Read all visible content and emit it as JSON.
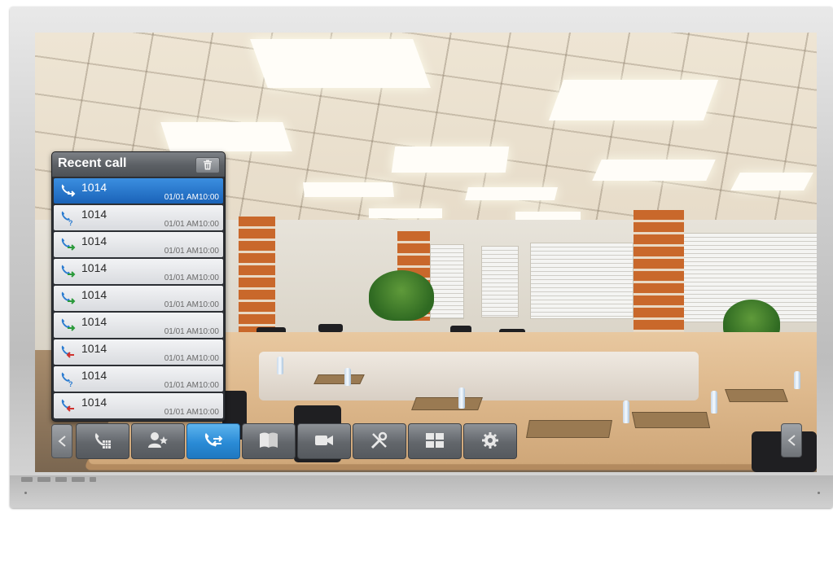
{
  "recent_call": {
    "title": "Recent call",
    "calls": [
      {
        "number": "1014",
        "time": "01/01 AM10:00",
        "type": "outgoing",
        "selected": true
      },
      {
        "number": "1014",
        "time": "01/01 AM10:00",
        "type": "missed"
      },
      {
        "number": "1014",
        "time": "01/01 AM10:00",
        "type": "outgoing"
      },
      {
        "number": "1014",
        "time": "01/01 AM10:00",
        "type": "outgoing"
      },
      {
        "number": "1014",
        "time": "01/01 AM10:00",
        "type": "outgoing"
      },
      {
        "number": "1014",
        "time": "01/01 AM10:00",
        "type": "outgoing"
      },
      {
        "number": "1014",
        "time": "01/01 AM10:00",
        "type": "incoming"
      },
      {
        "number": "1014",
        "time": "01/01 AM10:00",
        "type": "missed"
      },
      {
        "number": "1014",
        "time": "01/01 AM10:00",
        "type": "incoming"
      }
    ]
  },
  "toolbar": {
    "buttons": [
      {
        "icon": "dialpad-icon",
        "active": false
      },
      {
        "icon": "contacts-icon",
        "active": false
      },
      {
        "icon": "recent-calls-icon",
        "active": true
      },
      {
        "icon": "phonebook-icon",
        "active": false
      },
      {
        "icon": "video-camera-icon",
        "active": false
      },
      {
        "icon": "tools-icon",
        "active": false
      },
      {
        "icon": "layout-grid-icon",
        "active": false
      },
      {
        "icon": "settings-gear-icon",
        "active": false
      }
    ]
  },
  "colors": {
    "accent": "#2a8bd6",
    "incoming": "#d0312d",
    "outgoing": "#2a9a3a",
    "missed": "#2a7bd0"
  }
}
